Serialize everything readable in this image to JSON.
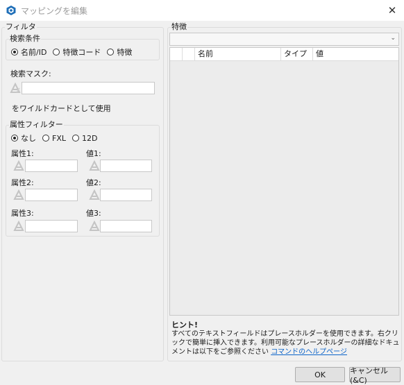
{
  "window": {
    "title": "マッピングを編集"
  },
  "filter": {
    "group_label": "フィルタ",
    "search_condition": {
      "label": "検索条件",
      "options": [
        "名前/ID",
        "特徴コード",
        "特徴"
      ],
      "selected": "名前/ID"
    },
    "search_mask": {
      "label": "検索マスク:",
      "value": "",
      "wildcard_note": "をワイルドカードとして使用"
    },
    "attribute_filter": {
      "label": "属性フィルター",
      "options": [
        "なし",
        "FXL",
        "12D"
      ],
      "selected": "なし",
      "fields": [
        {
          "attr_label": "属性1:",
          "value_label": "値1:"
        },
        {
          "attr_label": "属性2:",
          "value_label": "値2:"
        },
        {
          "attr_label": "属性3:",
          "value_label": "値3:"
        }
      ]
    }
  },
  "features": {
    "group_label": "特徴",
    "combo_value": "",
    "columns": [
      "名前",
      "タイプ",
      "値"
    ]
  },
  "hint": {
    "title": "ヒント!",
    "text": "すべてのテキストフィールドはプレースホルダーを使用できます。右クリックで簡単に挿入できます。利用可能なプレースホルダーの詳細なドキュメントは以下をご参照ください ",
    "link": "コマンドのヘルプページ"
  },
  "buttons": {
    "ok": "OK",
    "cancel": "キャンセル(&C)"
  },
  "icons": {
    "app": "cube-icon",
    "close": "close-icon",
    "placeholder": "placeholder-insert-icon"
  }
}
